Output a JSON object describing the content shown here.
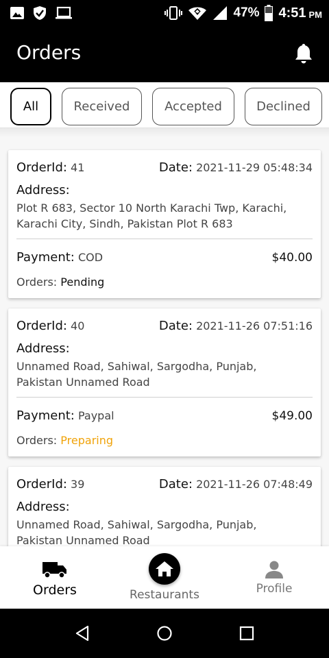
{
  "status_bar": {
    "battery": "47%",
    "time": "4:51",
    "ampm": "PM"
  },
  "app_bar": {
    "title": "Orders"
  },
  "filters": [
    {
      "label": "All",
      "active": true
    },
    {
      "label": "Received",
      "active": false
    },
    {
      "label": "Accepted",
      "active": false
    },
    {
      "label": "Declined",
      "active": false
    }
  ],
  "labels": {
    "order_id": "OrderId:",
    "date": "Date:",
    "address": "Address:",
    "payment": "Payment:",
    "orders": "Orders:"
  },
  "orders": [
    {
      "id": "41",
      "date": "2021-11-29 05:48:34",
      "address_line1": "Plot R 683, Sector 10 North Karachi Twp, Karachi,",
      "address_line2": "Karachi City, Sindh, Pakistan Plot R 683",
      "payment": "COD",
      "amount": "$40.00",
      "status": "Pending",
      "status_color": "#111111"
    },
    {
      "id": "40",
      "date": "2021-11-26 07:51:16",
      "address_line1": "Unnamed Road, Sahiwal, Sargodha, Punjab,",
      "address_line2": "Pakistan Unnamed Road",
      "payment": "Paypal",
      "amount": "$49.00",
      "status": "Preparing",
      "status_color": "#f0a30a"
    },
    {
      "id": "39",
      "date": "2021-11-26 07:48:49",
      "address_line1": "Unnamed Road, Sahiwal, Sargodha, Punjab,",
      "address_line2": "Pakistan Unnamed Road"
    }
  ],
  "bottom_nav": {
    "orders": "Orders",
    "restaurants": "Restaurants",
    "profile": "Profile"
  },
  "icons": {
    "gallery": "image-icon",
    "shield": "shield-icon",
    "laptop": "laptop-icon",
    "vibrate": "vibrate-icon",
    "wifi": "wifi-icon",
    "signal": "signal-icon",
    "battery": "battery-icon",
    "bell": "bell-icon",
    "truck": "truck-icon",
    "home": "home-icon",
    "person": "person-icon",
    "back": "back-icon",
    "home_button": "home-button-icon",
    "recents": "recents-icon"
  }
}
